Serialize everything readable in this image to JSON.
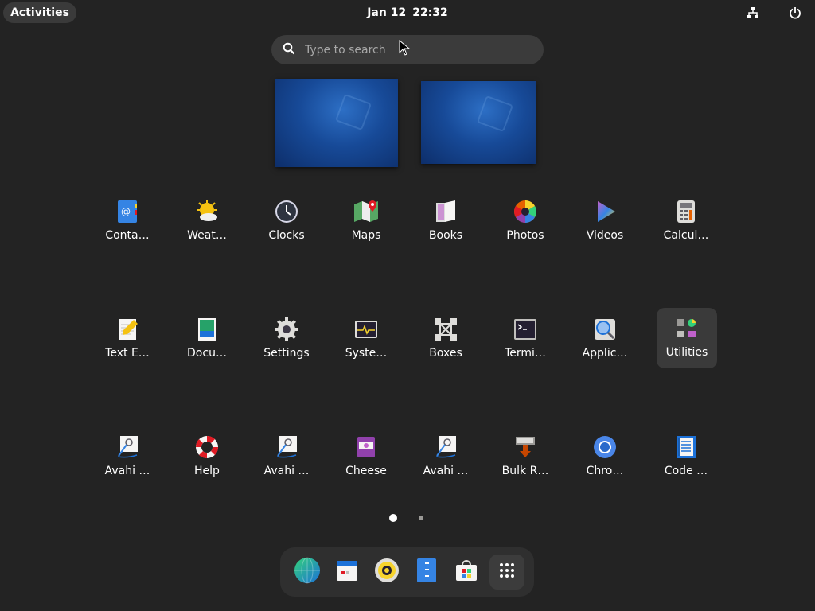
{
  "topbar": {
    "activities": "Activities",
    "date": "Jan 12",
    "time": "22:32",
    "network_icon": "network-wired-icon",
    "power_icon": "power-icon"
  },
  "search": {
    "placeholder": "Type to search",
    "icon": "search-icon"
  },
  "app_grid": {
    "rows": [
      [
        {
          "label": "Conta…",
          "icon": "contacts-icon"
        },
        {
          "label": "Weat…",
          "icon": "weather-icon"
        },
        {
          "label": "Clocks",
          "icon": "clocks-icon"
        },
        {
          "label": "Maps",
          "icon": "maps-icon"
        },
        {
          "label": "Books",
          "icon": "books-icon"
        },
        {
          "label": "Photos",
          "icon": "photos-icon"
        },
        {
          "label": "Videos",
          "icon": "videos-icon"
        },
        {
          "label": "Calcul…",
          "icon": "calculator-icon"
        }
      ],
      [
        {
          "label": "Text E…",
          "icon": "text-editor-icon"
        },
        {
          "label": "Docu…",
          "icon": "document-viewer-icon"
        },
        {
          "label": "Settings",
          "icon": "settings-icon"
        },
        {
          "label": "Syste…",
          "icon": "system-monitor-icon"
        },
        {
          "label": "Boxes",
          "icon": "boxes-icon"
        },
        {
          "label": "Termi…",
          "icon": "terminal-icon"
        },
        {
          "label": "Applic…",
          "icon": "application-finder-icon"
        },
        {
          "label": "Utilities",
          "icon": "utilities-folder-icon"
        }
      ],
      [
        {
          "label": "Avahi …",
          "icon": "avahi-icon"
        },
        {
          "label": "Help",
          "icon": "help-icon"
        },
        {
          "label": "Avahi …",
          "icon": "avahi-icon"
        },
        {
          "label": "Cheese",
          "icon": "cheese-icon"
        },
        {
          "label": "Avahi …",
          "icon": "avahi-icon"
        },
        {
          "label": "Bulk R…",
          "icon": "bulk-rename-icon"
        },
        {
          "label": "Chro…",
          "icon": "chromium-icon"
        },
        {
          "label": "Code …",
          "icon": "code-icon"
        }
      ]
    ]
  },
  "pagination": {
    "pages": 2,
    "current": 1
  },
  "dock": {
    "items": [
      {
        "icon": "web-browser-icon"
      },
      {
        "icon": "calendar-icon"
      },
      {
        "icon": "rhythmbox-icon"
      },
      {
        "icon": "files-icon"
      },
      {
        "icon": "software-icon"
      },
      {
        "icon": "show-apps-grid-icon"
      }
    ]
  },
  "colors": {
    "background": "#232323",
    "search_bg": "#3b3b3b",
    "selected_tile": "#3a3a3a",
    "accent_blue": "#3584e4"
  }
}
